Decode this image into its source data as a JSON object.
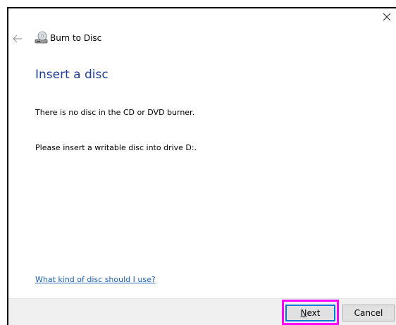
{
  "window": {
    "title": "Burn to Disc"
  },
  "icons": {
    "back": "back-arrow-icon",
    "close": "close-icon",
    "title": "disc-burner-icon"
  },
  "main": {
    "heading": "Insert a disc",
    "message_no_disc": "There is no disc in the CD or DVD burner.",
    "message_insert": "Please insert a writable disc into drive D:.",
    "help_link": "What kind of disc should I use?"
  },
  "footer": {
    "next_mnemonic": "N",
    "next_rest": "ext",
    "cancel_label": "Cancel"
  },
  "colors": {
    "heading": "#1f3f97",
    "link": "#1a5fb4",
    "highlight": "#ff00ff",
    "focus": "#0078d7"
  }
}
